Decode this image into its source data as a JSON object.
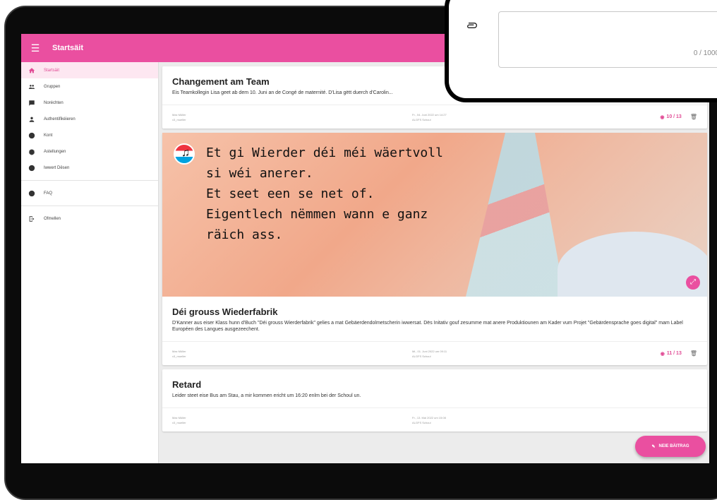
{
  "appbar": {
    "title": "Startsäit"
  },
  "sidebar": {
    "items": [
      {
        "label": "Startsäit",
        "icon": "home-icon",
        "active": true
      },
      {
        "label": "Gruppen",
        "icon": "group-icon"
      },
      {
        "label": "Noréchten",
        "icon": "message-icon"
      },
      {
        "label": "Authentifikéieren",
        "icon": "person-icon"
      },
      {
        "label": "Kont",
        "icon": "account-icon"
      },
      {
        "label": "Astellungen",
        "icon": "settings-icon"
      },
      {
        "label": "Iwwert Dësen",
        "icon": "info-icon"
      }
    ],
    "secondary": [
      {
        "label": "FAQ",
        "icon": "help-icon"
      }
    ],
    "logout": {
      "label": "Ofmellen",
      "icon": "logout-icon"
    }
  },
  "posts": [
    {
      "title": "Changement am Team",
      "body": "Eis Teamkollegin Lisa geet ab dem 10. Juni an de Congé de maternité. D'Lisa gëtt duerch d'Carolin...",
      "author": "Max Müller",
      "user": "x3_mueller",
      "date": "Fr., 04. Juni 2022 um 14:27",
      "school": "ALGFS Schoul",
      "views": "10 / 13"
    },
    {
      "title": "Déi grouss Wiederfabrik",
      "body": "D'Kanner aus eiser Klass hunn d'Buch \"Déi grouss Wierderfabrik\" gelies a mat Gebäerdendolmetscherin iwwersat. Dës Initativ gouf zesumme mat anere Produktiounen am Kader vum Projet \"Gebärdensprache goes digital\" mam Label Européen des Langues ausgezeechent.",
      "author": "Max Müller",
      "user": "x3_mueller",
      "date": "Mi., 01. Juni 2022 um 09:11",
      "school": "ALGFS Schoul",
      "views": "11 / 13",
      "image_text": [
        "Et gi Wierder déi méi wäertvoll",
        "si wéi anerer.",
        "Et seet een se net of.",
        "Eigentlech nëmmen wann e ganz",
        "räich ass."
      ]
    },
    {
      "title": "Retard",
      "body": "Leider steet eise Bus am Stau, a mir kommen ericht um 16:20 enlm bei der Schoul un.",
      "author": "Max Müller",
      "user": "x3_mueller",
      "date": "Fr., 13. Mai 2022 um 15:08",
      "school": "ALGFS Schoul"
    }
  ],
  "fab": {
    "label": "NEIE BÄITRAG",
    "icon": "pencil-icon"
  },
  "phone": {
    "counter": "0 / 1000",
    "icon": "attachment-icon"
  },
  "colors": {
    "brand": "#ea4fa0",
    "active_bg": "#fde7f1"
  }
}
